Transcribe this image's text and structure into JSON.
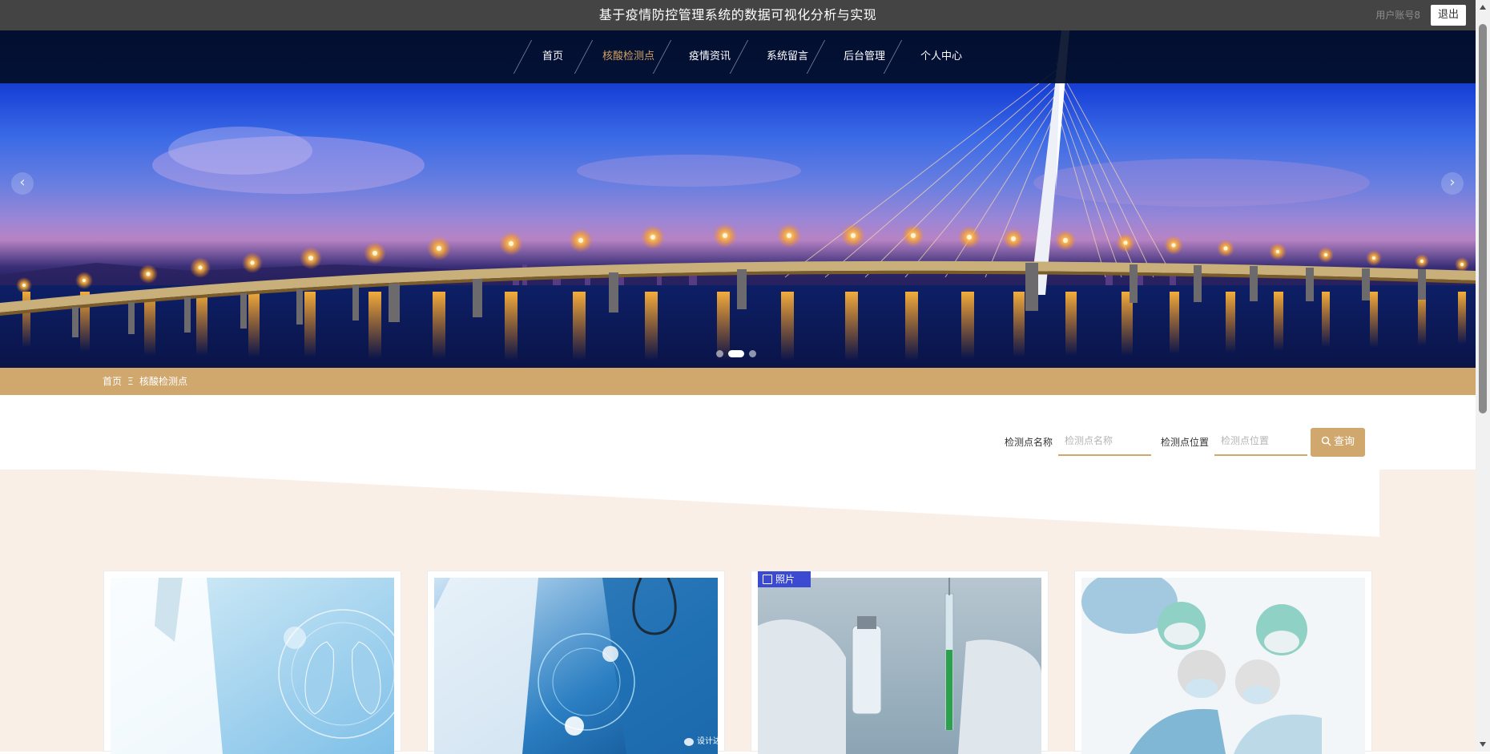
{
  "header": {
    "site_title": "基于疫情防控管理系统的数据可视化分析与实现",
    "account_label": "用户账号8",
    "logout_label": "退出"
  },
  "nav": {
    "items": [
      {
        "label": "首页"
      },
      {
        "label": "核酸检测点",
        "active": true
      },
      {
        "label": "疫情资讯"
      },
      {
        "label": "系统留言"
      },
      {
        "label": "后台管理"
      },
      {
        "label": "个人中心"
      }
    ],
    "active_color": "#d2a362"
  },
  "carousel": {
    "prev_label": "‹",
    "next_label": "›",
    "slide_count": 3,
    "active_slide": 2
  },
  "breadcrumb": {
    "home": "首页",
    "separator": "Ξ",
    "current": "核酸检测点"
  },
  "search": {
    "name_label": "检测点名称",
    "name_placeholder": "检测点名称",
    "location_label": "检测点位置",
    "location_placeholder": "检测点位置",
    "button_label": "查询",
    "button_icon": "search-icon"
  },
  "cards": [
    {
      "image": "doctor-lungs-photo"
    },
    {
      "image": "doctor-digital-health-photo",
      "watermark": "设计达"
    },
    {
      "image": "vaccine-vial-syringe-photo",
      "tag": "照片"
    },
    {
      "image": "surgeons-team-photo"
    }
  ],
  "colors": {
    "accent": "#d0a76d",
    "topbar": "#444444",
    "navbar": "#020e28",
    "content_bg": "#f9efe6",
    "photo_tag": "#3b4ad0"
  }
}
